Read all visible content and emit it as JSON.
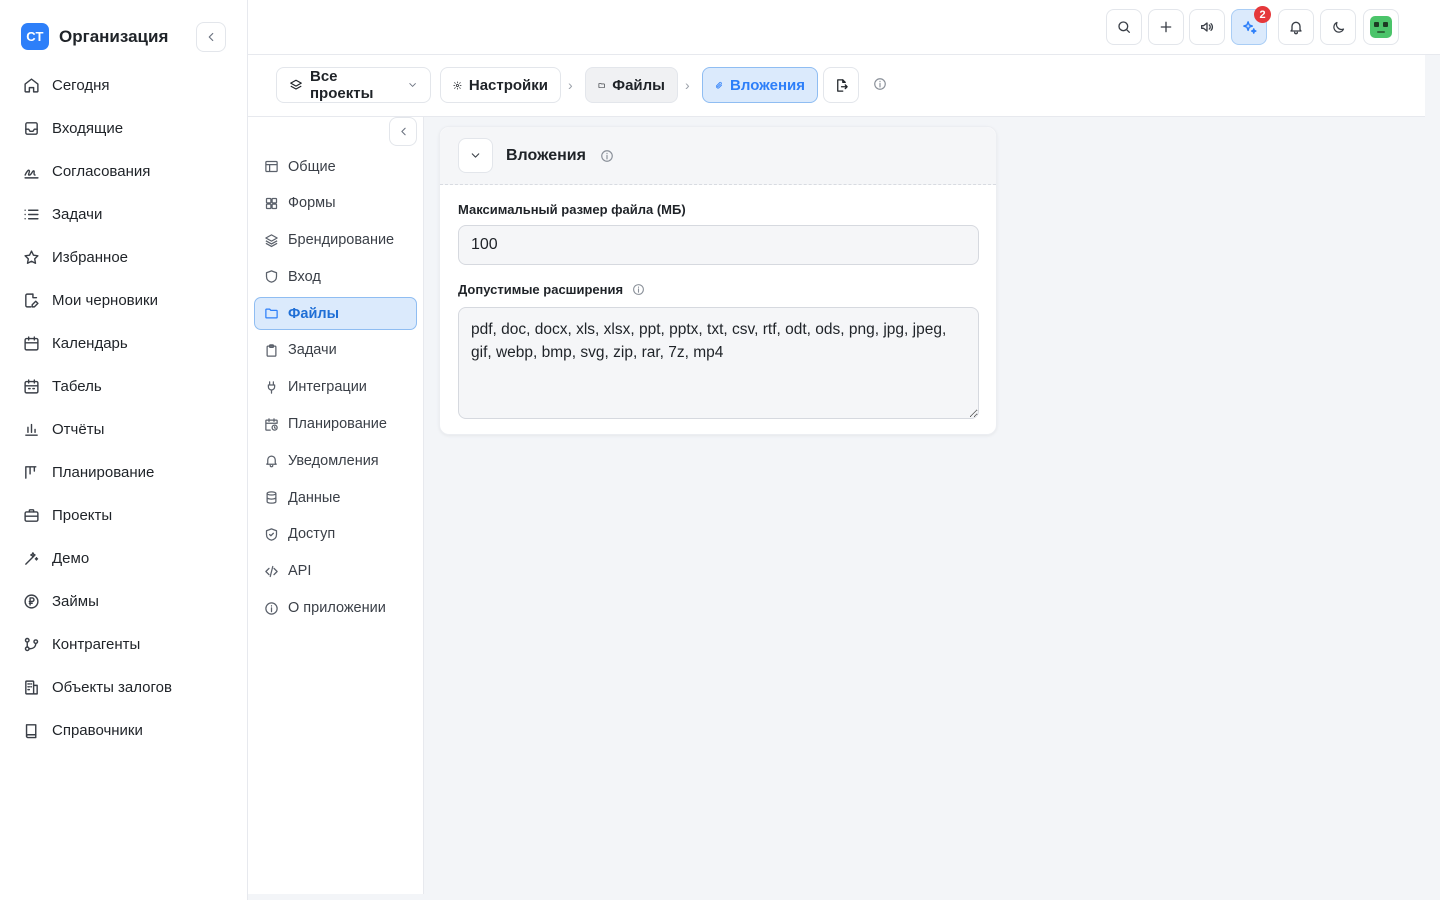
{
  "brand": {
    "logo_text": "СТ",
    "name": "Организация"
  },
  "nav": [
    {
      "label": "Сегодня",
      "icon": "home-icon"
    },
    {
      "label": "Входящие",
      "icon": "inbox-icon"
    },
    {
      "label": "Согласования",
      "icon": "signature-icon"
    },
    {
      "label": "Задачи",
      "icon": "list-icon"
    },
    {
      "label": "Избранное",
      "icon": "star-icon"
    },
    {
      "label": "Мои черновики",
      "icon": "draft-icon"
    },
    {
      "label": "Календарь",
      "icon": "calendar-icon"
    },
    {
      "label": "Табель",
      "icon": "timesheet-icon"
    },
    {
      "label": "Отчёты",
      "icon": "chart-icon"
    },
    {
      "label": "Планирование",
      "icon": "kanban-icon"
    },
    {
      "label": "Проекты",
      "icon": "briefcase-icon"
    },
    {
      "label": "Демо",
      "icon": "wand-icon"
    },
    {
      "label": "Займы",
      "icon": "ruble-icon"
    },
    {
      "label": "Контрагенты",
      "icon": "network-icon"
    },
    {
      "label": "Объекты залогов",
      "icon": "building-icon"
    },
    {
      "label": "Справочники",
      "icon": "book-icon"
    }
  ],
  "topbar": {
    "ai_badge_count": "2"
  },
  "breadcrumbs": {
    "all_projects": "Все проекты",
    "settings": "Настройки",
    "files": "Файлы",
    "attachments": "Вложения"
  },
  "subnav": [
    {
      "label": "Общие",
      "icon": "layout-icon"
    },
    {
      "label": "Формы",
      "icon": "grid-icon"
    },
    {
      "label": "Брендирование",
      "icon": "layers-icon"
    },
    {
      "label": "Вход",
      "icon": "shield-icon"
    },
    {
      "label": "Файлы",
      "icon": "folder-icon",
      "active": true
    },
    {
      "label": "Задачи",
      "icon": "clipboard-icon"
    },
    {
      "label": "Интеграции",
      "icon": "plug-icon"
    },
    {
      "label": "Планирование",
      "icon": "calendar-clock-icon"
    },
    {
      "label": "Уведомления",
      "icon": "bell-icon"
    },
    {
      "label": "Данные",
      "icon": "database-icon"
    },
    {
      "label": "Доступ",
      "icon": "shield-check-icon"
    },
    {
      "label": "API",
      "icon": "code-icon"
    },
    {
      "label": "О приложении",
      "icon": "info-icon"
    }
  ],
  "card": {
    "title": "Вложения",
    "max_size_label": "Максимальный размер файла (МБ)",
    "max_size_value": "100",
    "extensions_label": "Допустимые расширения",
    "extensions_value": "pdf, doc, docx, xls, xlsx, ppt, pptx, txt, csv, rtf, odt, ods, png, jpg, jpeg, gif, webp, bmp, svg, zip, rar, 7z, mp4"
  },
  "colors": {
    "accent": "#2d7ff9",
    "accent_bg": "#dbeafc",
    "badge": "#e5383b"
  }
}
